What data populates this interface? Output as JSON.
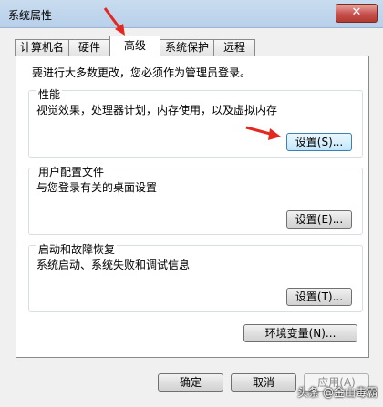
{
  "window": {
    "title": "系统属性",
    "close_label": "✕"
  },
  "tabs": [
    {
      "label": "计算机名"
    },
    {
      "label": "硬件"
    },
    {
      "label": "高级"
    },
    {
      "label": "系统保护"
    },
    {
      "label": "远程"
    }
  ],
  "note": "要进行大多数更改，您必须作为管理员登录。",
  "performance": {
    "title": "性能",
    "desc": "视觉效果，处理器计划，内存使用，以及虚拟内存",
    "button": "设置(S)..."
  },
  "profiles": {
    "title": "用户配置文件",
    "desc": "与您登录有关的桌面设置",
    "button": "设置(E)..."
  },
  "startup": {
    "title": "启动和故障恢复",
    "desc": "系统启动、系统失败和调试信息",
    "button": "设置(T)..."
  },
  "env_button": "环境变量(N)...",
  "footer": {
    "ok": "确定",
    "cancel": "取消",
    "apply": "应用(A)"
  },
  "watermark": "头条 @金山毒霸",
  "colors": {
    "arrow": "#e5281f",
    "focus_border": "#3c7fb1"
  }
}
